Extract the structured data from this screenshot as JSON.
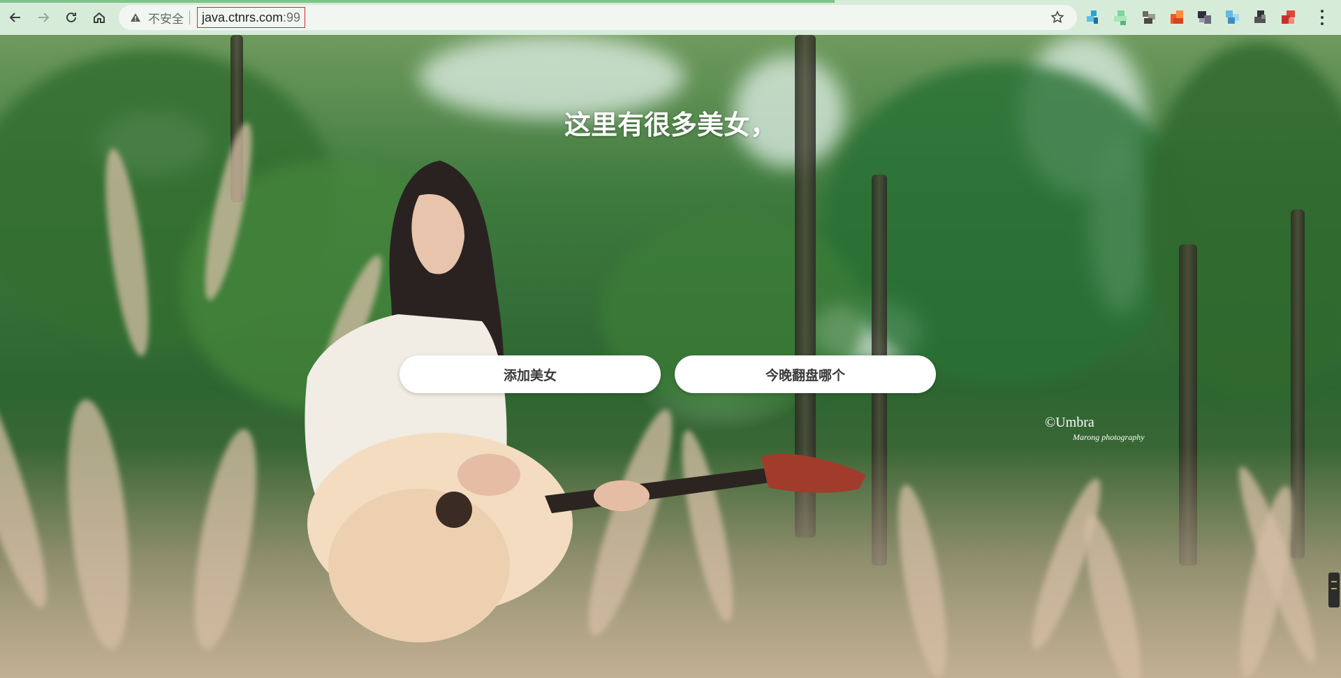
{
  "browser": {
    "security_text": "不安全",
    "url_host": "java.ctnrs.com",
    "url_port": ":99",
    "accent_color": "#d3272b"
  },
  "page": {
    "headline": "这里有很多美女，",
    "buttons": [
      {
        "label": "添加美女"
      },
      {
        "label": "今晚翻盘哪个"
      }
    ],
    "watermark": {
      "main": "©Umbra",
      "sub": "Marong photography"
    }
  }
}
